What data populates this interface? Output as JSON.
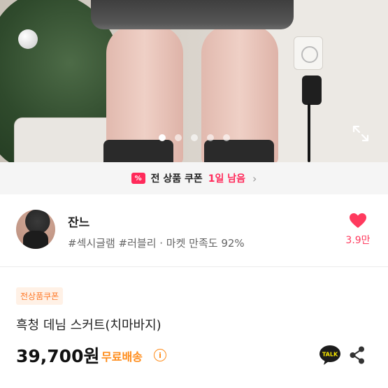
{
  "carousel": {
    "page_count": 5,
    "active_index": 0
  },
  "coupon_banner": {
    "icon_text": "%",
    "text": "전 상품 쿠폰",
    "remaining": "1일 남음",
    "chevron": "›"
  },
  "seller": {
    "name": "잔느",
    "tags": "#섹시글램 #러블리 · 마켓 만족도 92%",
    "like_count": "3.9만"
  },
  "product": {
    "badge": "전상품쿠폰",
    "name": "흑청 데님 스커트(치마바지)",
    "price": "39,700원",
    "shipping": "무료배송",
    "info_glyph": "i"
  },
  "icons": {
    "expand": "expand-icon",
    "coupon": "coupon-icon",
    "heart": "heart-icon",
    "talk": "kakaotalk-icon",
    "share": "share-icon"
  },
  "colors": {
    "accent_pink": "#ff2a5a",
    "like_pink": "#ff3a5e",
    "shipping_orange": "#ff8c1a",
    "badge_bg": "#fff1e6"
  }
}
